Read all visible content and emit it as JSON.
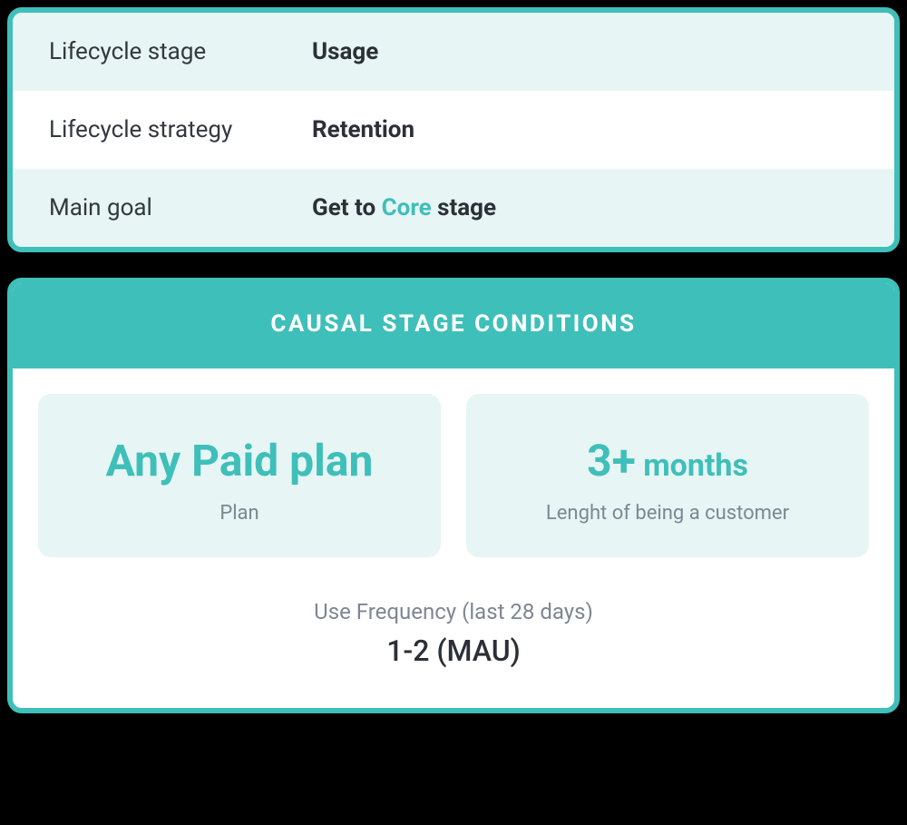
{
  "summary": {
    "rows": [
      {
        "label": "Lifecycle stage",
        "value": "Usage",
        "highlight": null
      },
      {
        "label": "Lifecycle strategy",
        "value": "Retention",
        "highlight": null
      },
      {
        "label": "Main goal",
        "value_prefix": "Get to ",
        "highlight": "Core",
        "value_suffix": " stage"
      }
    ]
  },
  "conditions": {
    "banner": "CAUSAL STAGE CONDITIONS",
    "tiles": [
      {
        "title_big": "Any Paid plan",
        "title_small": null,
        "sub": "Plan"
      },
      {
        "title_big": "3+",
        "title_small": " months",
        "sub": "Lenght of being a customer"
      }
    ],
    "frequency": {
      "label": "Use Frequency (last 28 days)",
      "value": "1-2 (MAU)"
    }
  }
}
